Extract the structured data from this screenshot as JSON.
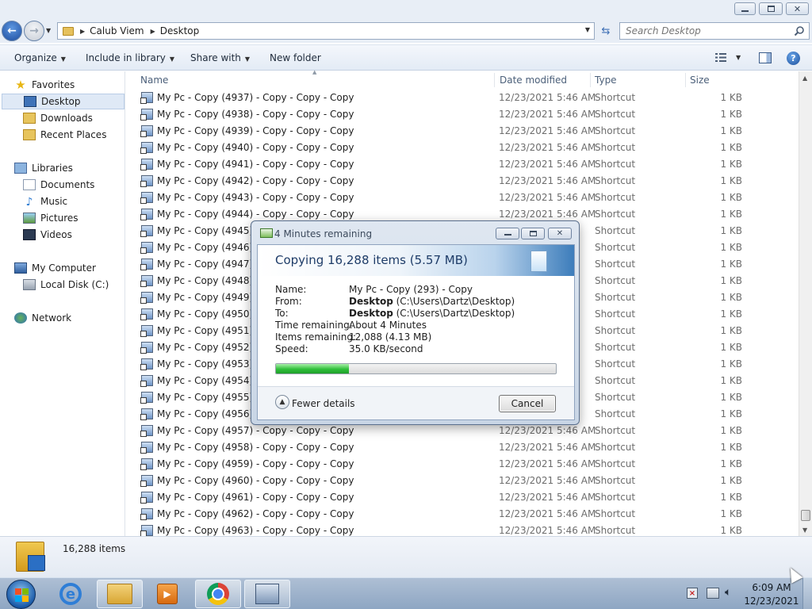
{
  "window": {
    "controls": {
      "minimize_icon": "minimize-icon",
      "maximize_icon": "maximize-icon",
      "close_icon": "close-icon",
      "close_glyph": "✕"
    }
  },
  "address_bar": {
    "breadcrumbs": [
      "Calub Viem",
      "Desktop"
    ],
    "search_placeholder": "Search Desktop"
  },
  "toolbar": {
    "organize": "Organize",
    "include_in_library": "Include in library",
    "share_with": "Share with",
    "new_folder": "New folder"
  },
  "nav_pane": {
    "favorites": {
      "label": "Favorites",
      "items": [
        "Desktop",
        "Downloads",
        "Recent Places"
      ]
    },
    "libraries": {
      "label": "Libraries",
      "items": [
        "Documents",
        "Music",
        "Pictures",
        "Videos"
      ]
    },
    "computer": {
      "label": "My Computer",
      "items": [
        "Local Disk (C:)"
      ]
    },
    "network": {
      "label": "Network"
    }
  },
  "file_list": {
    "columns": {
      "name": "Name",
      "date_modified": "Date modified",
      "type": "Type",
      "size": "Size"
    },
    "rows": [
      {
        "name": "My Pc - Copy (4937) - Copy - Copy - Copy",
        "date": "12/23/2021 5:46 AM",
        "type": "Shortcut",
        "size": "1 KB"
      },
      {
        "name": "My Pc - Copy (4938) - Copy - Copy - Copy",
        "date": "12/23/2021 5:46 AM",
        "type": "Shortcut",
        "size": "1 KB"
      },
      {
        "name": "My Pc - Copy (4939) - Copy - Copy - Copy",
        "date": "12/23/2021 5:46 AM",
        "type": "Shortcut",
        "size": "1 KB"
      },
      {
        "name": "My Pc - Copy (4940) - Copy - Copy - Copy",
        "date": "12/23/2021 5:46 AM",
        "type": "Shortcut",
        "size": "1 KB"
      },
      {
        "name": "My Pc - Copy (4941) - Copy - Copy - Copy",
        "date": "12/23/2021 5:46 AM",
        "type": "Shortcut",
        "size": "1 KB"
      },
      {
        "name": "My Pc - Copy (4942) - Copy - Copy - Copy",
        "date": "12/23/2021 5:46 AM",
        "type": "Shortcut",
        "size": "1 KB"
      },
      {
        "name": "My Pc - Copy (4943) - Copy - Copy - Copy",
        "date": "12/23/2021 5:46 AM",
        "type": "Shortcut",
        "size": "1 KB"
      },
      {
        "name": "My Pc - Copy (4944) - Copy - Copy - Copy",
        "date": "12/23/2021 5:46 AM",
        "type": "Shortcut",
        "size": "1 KB"
      },
      {
        "name": "My Pc - Copy (4945)",
        "date": "",
        "type": "Shortcut",
        "size": "1 KB"
      },
      {
        "name": "My Pc - Copy (4946)",
        "date": "",
        "type": "Shortcut",
        "size": "1 KB"
      },
      {
        "name": "My Pc - Copy (4947)",
        "date": "",
        "type": "Shortcut",
        "size": "1 KB"
      },
      {
        "name": "My Pc - Copy (4948)",
        "date": "",
        "type": "Shortcut",
        "size": "1 KB"
      },
      {
        "name": "My Pc - Copy (4949)",
        "date": "",
        "type": "Shortcut",
        "size": "1 KB"
      },
      {
        "name": "My Pc - Copy (4950)",
        "date": "",
        "type": "Shortcut",
        "size": "1 KB"
      },
      {
        "name": "My Pc - Copy (4951)",
        "date": "",
        "type": "Shortcut",
        "size": "1 KB"
      },
      {
        "name": "My Pc - Copy (4952)",
        "date": "",
        "type": "Shortcut",
        "size": "1 KB"
      },
      {
        "name": "My Pc - Copy (4953)",
        "date": "",
        "type": "Shortcut",
        "size": "1 KB"
      },
      {
        "name": "My Pc - Copy (4954)",
        "date": "",
        "type": "Shortcut",
        "size": "1 KB"
      },
      {
        "name": "My Pc - Copy (4955)",
        "date": "",
        "type": "Shortcut",
        "size": "1 KB"
      },
      {
        "name": "My Pc - Copy (4956)",
        "date": "",
        "type": "Shortcut",
        "size": "1 KB"
      },
      {
        "name": "My Pc - Copy (4957) - Copy - Copy - Copy",
        "date": "12/23/2021 5:46 AM",
        "type": "Shortcut",
        "size": "1 KB"
      },
      {
        "name": "My Pc - Copy (4958) - Copy - Copy - Copy",
        "date": "12/23/2021 5:46 AM",
        "type": "Shortcut",
        "size": "1 KB"
      },
      {
        "name": "My Pc - Copy (4959) - Copy - Copy - Copy",
        "date": "12/23/2021 5:46 AM",
        "type": "Shortcut",
        "size": "1 KB"
      },
      {
        "name": "My Pc - Copy (4960) - Copy - Copy - Copy",
        "date": "12/23/2021 5:46 AM",
        "type": "Shortcut",
        "size": "1 KB"
      },
      {
        "name": "My Pc - Copy (4961) - Copy - Copy - Copy",
        "date": "12/23/2021 5:46 AM",
        "type": "Shortcut",
        "size": "1 KB"
      },
      {
        "name": "My Pc - Copy (4962) - Copy - Copy - Copy",
        "date": "12/23/2021 5:46 AM",
        "type": "Shortcut",
        "size": "1 KB"
      },
      {
        "name": "My Pc - Copy (4963) - Copy - Copy - Copy",
        "date": "12/23/2021 5:46 AM",
        "type": "Shortcut",
        "size": "1 KB"
      }
    ]
  },
  "details_pane": {
    "count": "16,288 items"
  },
  "copy_dialog": {
    "title": "4 Minutes remaining",
    "heading": "Copying 16,288 items (5.57 MB)",
    "name_label": "Name:",
    "name_value": "My Pc - Copy (293) - Copy",
    "from_label": "From:",
    "from_bold": "Desktop",
    "from_path": "(C:\\Users\\Dartz\\Desktop)",
    "to_label": "To:",
    "to_bold": "Desktop",
    "to_path": "(C:\\Users\\Dartz\\Desktop)",
    "time_label": "Time remaining:",
    "time_value": "About 4 Minutes",
    "items_label": "Items remaining:",
    "items_value": "12,088 (4.13 MB)",
    "speed_label": "Speed:",
    "speed_value": "35.0 KB/second",
    "progress_fraction": 0.26,
    "fewer_details": "Fewer details",
    "cancel": "Cancel"
  },
  "taskbar": {
    "apps": [
      "internet-explorer-icon",
      "windows-explorer-icon",
      "media-player-icon",
      "chrome-icon",
      "file-copy-icon"
    ],
    "clock_time": "6:09 AM",
    "clock_date": "12/23/2021"
  },
  "colors": {
    "accent": "#1d4c9e",
    "progress": "#2fbf3a",
    "selection": "#dfe9f6"
  }
}
